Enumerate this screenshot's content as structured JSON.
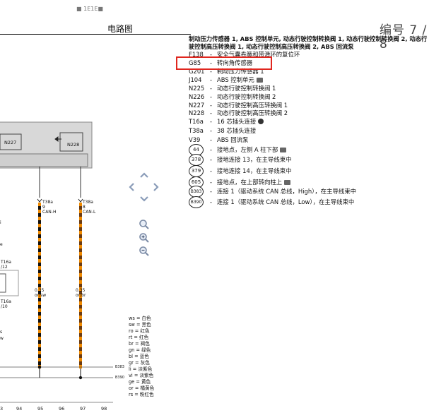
{
  "document": {
    "title": "电路图",
    "page_label": "编号 7 / 8",
    "top_fragment": "■ 1E1E■"
  },
  "legend": {
    "heading": "制动压力传感器 1, ABS 控制单元, 动态行驶控制转换阀 1, 动态行驶控制转换阀 2, 动态行驶控制高压转换阀 1, 动态行驶控制高压转换阀 2, ABS 回流泵",
    "items": [
      {
        "code": "F138",
        "desc": "安全气囊卷簧和带滑环的复位环",
        "icon": ""
      },
      {
        "code": "G85",
        "desc": "转向角传感器",
        "icon": ""
      },
      {
        "code": "G201",
        "desc": "制动压力传感器 1",
        "icon": ""
      },
      {
        "code": "J104",
        "desc": "ABS 控制单元",
        "icon": "camera-icon"
      },
      {
        "code": "N225",
        "desc": "动态行驶控制转换阀 1",
        "icon": ""
      },
      {
        "code": "N226",
        "desc": "动态行驶控制转换阀 2",
        "icon": ""
      },
      {
        "code": "N227",
        "desc": "动态行驶控制高压转换阀 1",
        "icon": ""
      },
      {
        "code": "N228",
        "desc": "动态行驶控制高压转换阀 2",
        "icon": ""
      },
      {
        "code": "T16a",
        "desc": "16 芯插头连接",
        "icon": "connector-icon"
      },
      {
        "code": "T38a",
        "desc": "38 芯插头连接",
        "icon": ""
      },
      {
        "code": "V39",
        "desc": "ABS 回流泵",
        "icon": ""
      }
    ],
    "ground_items": [
      {
        "code": "44",
        "desc": "接地点，左侧 A 柱下部",
        "icon": "camera-icon"
      },
      {
        "code": "378",
        "desc": "接地连接 13，在主导线束中",
        "icon": ""
      },
      {
        "code": "379",
        "desc": "接地连接 14，在主导线束中",
        "icon": ""
      },
      {
        "code": "605",
        "desc": "接地点，在上部转向柱上",
        "icon": "camera-icon"
      },
      {
        "code": "B383",
        "desc": "连接 1（驱动系统 CAN 总线，High），在主导线束中",
        "icon": ""
      },
      {
        "code": "B390",
        "desc": "连接 1（驱动系统 CAN 总线，Low），在主导线束中",
        "icon": ""
      }
    ],
    "highlighted_code": "G85"
  },
  "diagram": {
    "components": [
      "N227",
      "N228"
    ],
    "connectors": [
      {
        "label": "T38a",
        "pin": "9",
        "signal": "CAN-H"
      },
      {
        "label": "T38a",
        "pin": "8",
        "signal": "CAN-L"
      }
    ],
    "wire_labels": [
      {
        "gauge": "0.35",
        "color": "or/sw"
      },
      {
        "gauge": "0.35",
        "color": "or/br"
      }
    ],
    "left_fragments": [
      "T16a",
      "/12",
      "T16a",
      "/10",
      "e",
      "s",
      "w",
      "i"
    ],
    "bus_labels": [
      "B383",
      "B390"
    ],
    "wire_colors": {
      "orange": "#f08a00",
      "black": "#111111"
    }
  },
  "color_key": [
    {
      "code": "ws",
      "name": "白色"
    },
    {
      "code": "sw",
      "name": "黑色"
    },
    {
      "code": "ro",
      "name": "红色"
    },
    {
      "code": "rt",
      "name": "红色"
    },
    {
      "code": "br",
      "name": "褐色"
    },
    {
      "code": "gn",
      "name": "绿色"
    },
    {
      "code": "bl",
      "name": "蓝色"
    },
    {
      "code": "gr",
      "name": "灰色"
    },
    {
      "code": "li",
      "name": "淡紫色"
    },
    {
      "code": "vi",
      "name": "淡紫色"
    },
    {
      "code": "ge",
      "name": "黄色"
    },
    {
      "code": "or",
      "name": "橘黄色"
    },
    {
      "code": "rs",
      "name": "粉红色"
    }
  ],
  "axis_ticks": [
    "3",
    "94",
    "95",
    "96",
    "97",
    "98"
  ],
  "controls": {
    "pan_up": "chevron-up-icon",
    "pan_left": "chevron-left-icon",
    "pan_right": "chevron-right-icon",
    "pan_down": "chevron-down-icon",
    "zoom_fit": "zoom-icon",
    "zoom_in": "zoom-in-icon",
    "zoom_out": "zoom-out-icon"
  }
}
